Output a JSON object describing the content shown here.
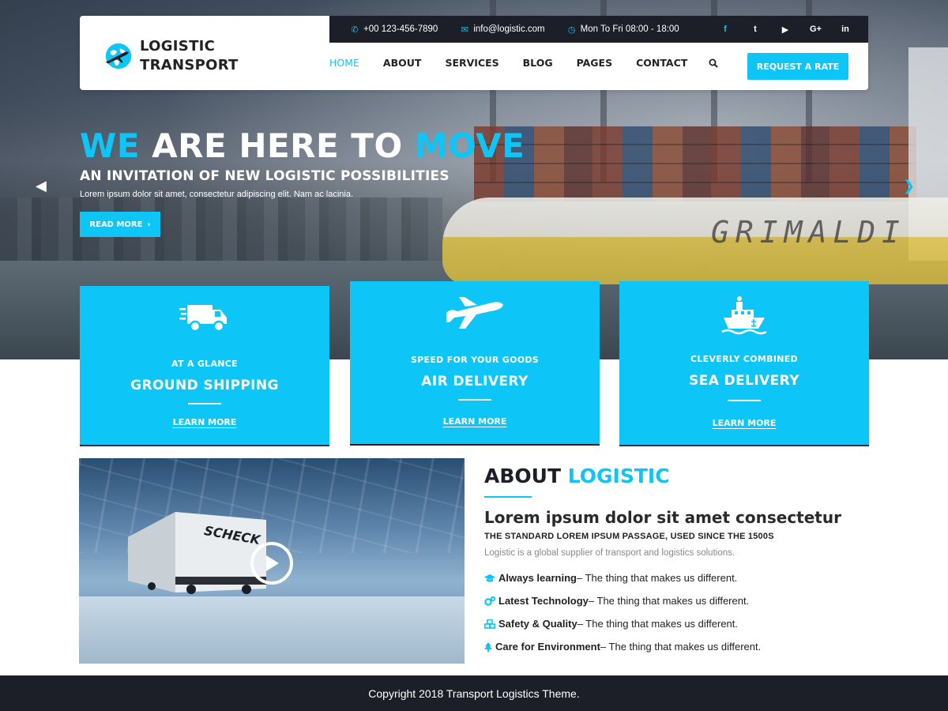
{
  "brand": {
    "line1": "LOGISTIC",
    "line2": "TRANSPORT",
    "accent": "#0dc5f6",
    "dark": "#1c1f27"
  },
  "topbar": {
    "phone": "+00 123-456-7890",
    "email": "info@logistic.com",
    "hours": "Mon To Fri 08:00 - 18:00",
    "social": [
      {
        "name": "facebook-icon",
        "glyph": "f"
      },
      {
        "name": "twitter-icon",
        "glyph": "t"
      },
      {
        "name": "youtube-icon",
        "glyph": "▶"
      },
      {
        "name": "google-plus-icon",
        "glyph": "G+"
      },
      {
        "name": "linkedin-icon",
        "glyph": "in"
      }
    ]
  },
  "nav": {
    "items": [
      "HOME",
      "ABOUT",
      "SERVICES",
      "BLOG",
      "PAGES",
      "CONTACT"
    ],
    "active": "HOME",
    "cta": "REQUEST A RATE"
  },
  "hero": {
    "title_accent_1": "WE",
    "title_middle": "ARE HERE TO",
    "title_accent_2": "MOVE",
    "subtitle": "AN INVITATION OF NEW LOGISTIC POSSIBILITIES",
    "description": "Lorem ipsum dolor sit amet, consectetur adipiscing elit. Nam ac lacinia.",
    "button": "READ MORE",
    "ship_text": "GRIMALDI"
  },
  "services": [
    {
      "kicker": "AT A GLANCE",
      "title": "GROUND SHIPPING",
      "link": "LEARN MORE",
      "icon": "truck-icon"
    },
    {
      "kicker": "SPEED FOR YOUR GOODS",
      "title": "AIR DELIVERY",
      "link": "LEARN MORE",
      "icon": "plane-icon"
    },
    {
      "kicker": "CLEVERLY COMBINED",
      "title": "SEA DELIVERY",
      "link": "LEARN MORE",
      "icon": "ship-icon"
    }
  ],
  "about": {
    "title_1": "ABOUT",
    "title_2": "LOGISTIC",
    "heading": "Lorem ipsum dolor sit amet consectetur",
    "kicker": "THE STANDARD LOREM IPSUM PASSAGE, USED SINCE THE 1500S",
    "description": "Logistic is a global supplier of transport and logistics solutions.",
    "truck_text": "SCHECK",
    "features": [
      {
        "bold": "Always learning",
        "text": " – The thing that makes us different.",
        "icon": "graduation-cap-icon"
      },
      {
        "bold": "Latest Technology",
        "text": " – The thing that makes us different.",
        "icon": "gears-icon"
      },
      {
        "bold": "Safety & Quality",
        "text": " – The thing that makes us different.",
        "icon": "cubes-icon"
      },
      {
        "bold": "Care for Environment",
        "text": " – The thing that makes us different.",
        "icon": "tree-icon"
      }
    ]
  },
  "footer": {
    "copyright": "Copyright 2018 Transport Logistics Theme."
  }
}
